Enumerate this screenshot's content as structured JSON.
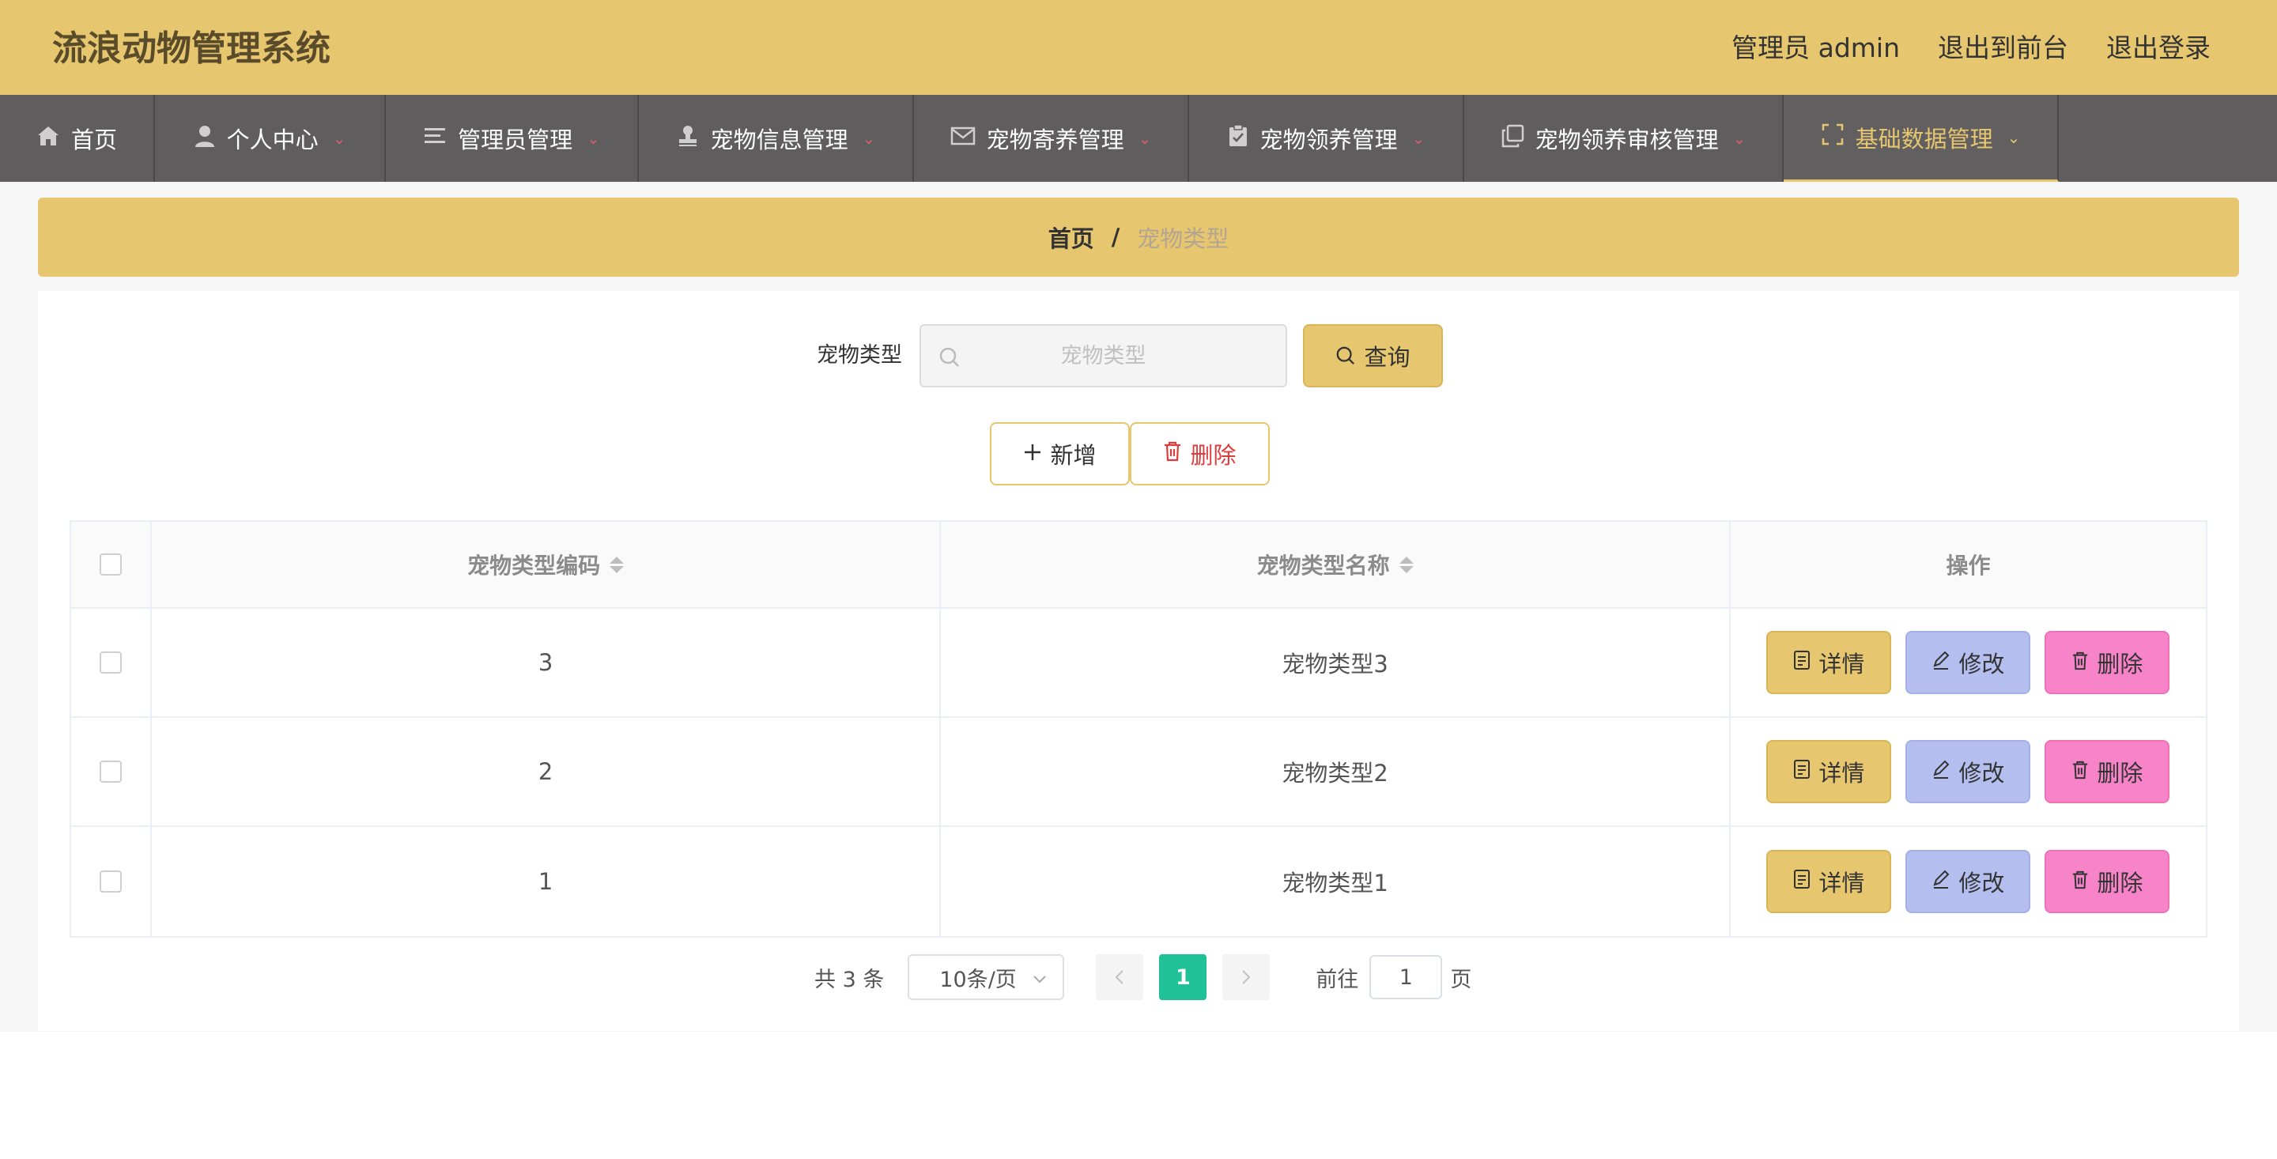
{
  "header": {
    "title": "流浪动物管理系统",
    "user_label": "管理员 admin",
    "front_link": "退出到前台",
    "logout_link": "退出登录"
  },
  "nav": {
    "items": [
      {
        "label": "首页",
        "icon": "home-icon",
        "has_caret": false
      },
      {
        "label": "个人中心",
        "icon": "user-icon",
        "has_caret": true
      },
      {
        "label": "管理员管理",
        "icon": "menu-lines-icon",
        "has_caret": true
      },
      {
        "label": "宠物信息管理",
        "icon": "stamp-icon",
        "has_caret": true
      },
      {
        "label": "宠物寄养管理",
        "icon": "mail-icon",
        "has_caret": true
      },
      {
        "label": "宠物领养管理",
        "icon": "clipboard-icon",
        "has_caret": true
      },
      {
        "label": "宠物领养审核管理",
        "icon": "copy-icon",
        "has_caret": true
      },
      {
        "label": "基础数据管理",
        "icon": "fullscreen-icon",
        "has_caret": true,
        "active": true
      }
    ]
  },
  "breadcrumb": {
    "home": "首页",
    "separator": "/",
    "current": "宠物类型"
  },
  "search": {
    "label": "宠物类型",
    "placeholder": "宠物类型",
    "value": "",
    "query_label": "查询"
  },
  "actions": {
    "add_label": "新增",
    "delete_label": "删除"
  },
  "table": {
    "columns": [
      "宠物类型编码",
      "宠物类型名称",
      "操作"
    ],
    "rows": [
      {
        "code": "3",
        "name": "宠物类型3"
      },
      {
        "code": "2",
        "name": "宠物类型2"
      },
      {
        "code": "1",
        "name": "宠物类型1"
      }
    ],
    "row_actions": {
      "detail": "详情",
      "edit": "修改",
      "delete": "删除"
    }
  },
  "pagination": {
    "total_text": "共 3 条",
    "page_size": "10条/页",
    "current_page": "1",
    "goto_label": "前往",
    "goto_value": "1",
    "page_unit": "页"
  },
  "colors": {
    "primary": "#e6c66e",
    "nav_bg": "#5f5d5e",
    "page_active": "#20c196",
    "edit": "#b4bff0",
    "delete": "#f783c8"
  }
}
